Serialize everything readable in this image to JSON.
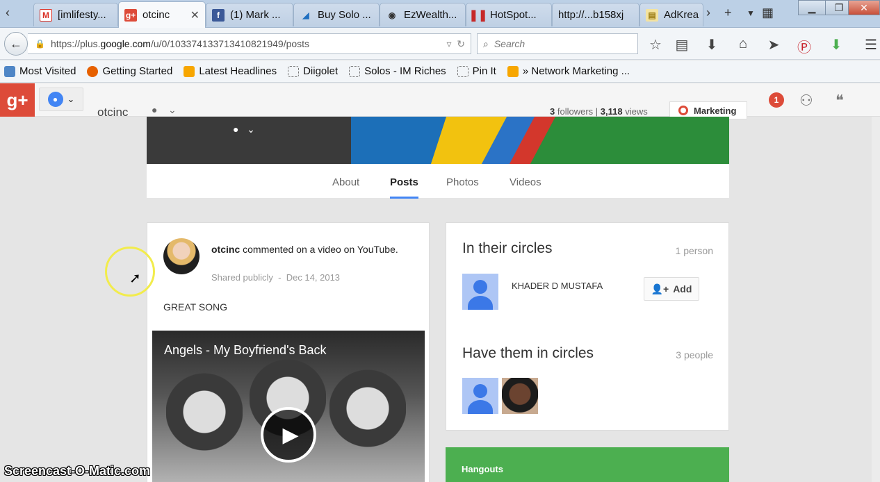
{
  "browser": {
    "tabs": [
      {
        "label": "[imlifesty...",
        "icon": "gmail-icon",
        "color": "#d93025"
      },
      {
        "label": "otcinc",
        "icon": "google-plus-icon",
        "color": "#dd4b39",
        "active": true
      },
      {
        "label": "(1) Mark ...",
        "icon": "facebook-icon",
        "color": "#3b5998"
      },
      {
        "label": "Buy Solo ...",
        "icon": "solo-icon",
        "color": "#1f6fc0"
      },
      {
        "label": "EzWealth...",
        "icon": "ezwealth-icon",
        "color": "#333333"
      },
      {
        "label": "HotSpot...",
        "icon": "hotspot-icon",
        "color": "#c62828"
      },
      {
        "label": "http://...b158xj",
        "icon": "blank-icon",
        "color": "#bcd0e6"
      },
      {
        "label": "AdKrea",
        "icon": "adkrea-icon",
        "color": "#e0c060"
      }
    ],
    "url_prefix": "https://plus.",
    "url_domain": "google.com",
    "url_path": "/u/0/103374133713410821949/posts",
    "search_placeholder": "Search",
    "bookmarks": [
      "Most Visited",
      "Getting Started",
      "Latest Headlines",
      "Diigolet",
      "Solos - IM Riches",
      "Pin It",
      "» Network Marketing ..."
    ]
  },
  "gplus": {
    "logo": "g+",
    "profile_name": "otcinc",
    "followers_count": "3",
    "followers_label": "followers",
    "views_count": "3,118",
    "views_label": "views",
    "circle_button": "Marketing",
    "notifications": "1"
  },
  "profile_tabs": [
    "About",
    "Posts",
    "Photos",
    "Videos"
  ],
  "active_tab": "Posts",
  "post": {
    "author": "otcinc",
    "action": "commented on a video on YouTube.",
    "visibility": "Shared publicly",
    "separator": "-",
    "date": "Dec 14, 2013",
    "text": "GREAT SONG",
    "video_title": "Angels - My Boyfriend's Back"
  },
  "circles": {
    "in_title": "In their circles",
    "in_count": "1 person",
    "person_name": "KHADER D MUSTAFA",
    "add_label": "Add",
    "have_title": "Have them in circles",
    "have_count": "3 people"
  },
  "hangouts": "Hangouts",
  "watermark": "Screencast-O-Matic.com",
  "colors": {
    "gplus_red": "#dd4b39",
    "blue": "#4285f4",
    "hangouts_green": "#4caf50"
  }
}
